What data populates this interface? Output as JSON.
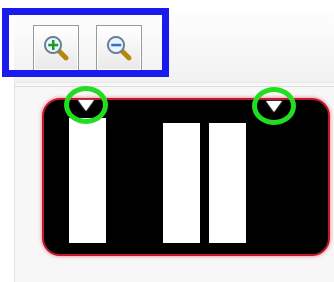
{
  "toolbar": {
    "buttons": [
      {
        "name": "zoom-in",
        "icon": "zoom-in-icon"
      },
      {
        "name": "zoom-out",
        "icon": "zoom-out-icon"
      }
    ]
  },
  "colors": {
    "highlight_box": "#1a1aee",
    "handle_ring": "#22dd22",
    "panel_background": "#000000",
    "panel_border": "#c2162b",
    "bars": "#ffffff"
  },
  "panel": {
    "bars": 3,
    "handles": [
      {
        "icon": "triangle-down-icon"
      },
      {
        "icon": "triangle-down-icon"
      }
    ]
  }
}
